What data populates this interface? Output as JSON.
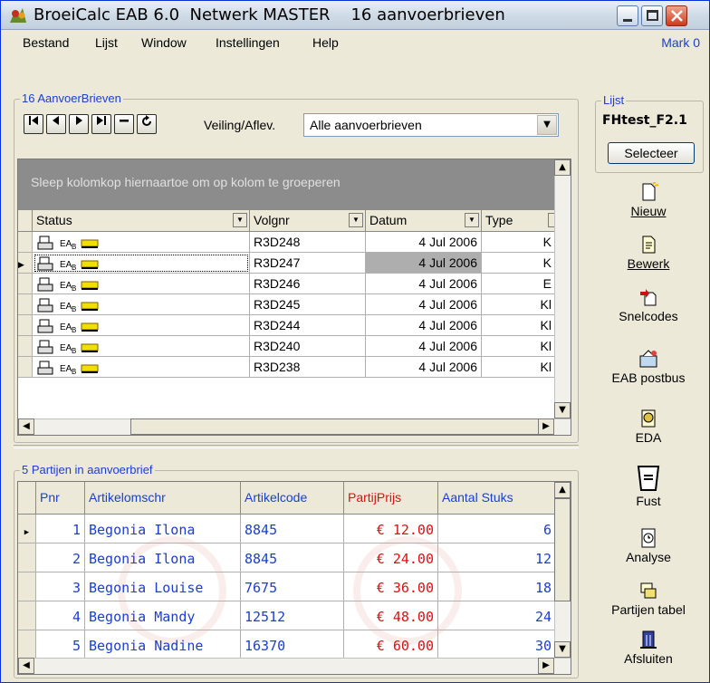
{
  "window": {
    "title": "BroeiCalc EAB 6.0  Netwerk MASTER    16 aanvoerbrieven",
    "app_icon": "broeicalc-logo-icon"
  },
  "menu": {
    "items": [
      "Bestand",
      "Lijst",
      "Window",
      "Instellingen",
      "Help"
    ],
    "user": "Mark 0"
  },
  "top_group": {
    "label": "16 AanvoerBrieven",
    "nav_buttons": [
      "first-record",
      "previous-record",
      "next-record",
      "last-record",
      "delete-record",
      "refresh"
    ],
    "veiling_label": "Veiling/Aflev.",
    "veiling_value": "Alle aanvoerbrieven",
    "group_hint": "Sleep kolomkop hiernaartoe om op kolom te groeperen",
    "columns": [
      "Status",
      "Volgnr",
      "Datum",
      "Type"
    ],
    "rows": [
      {
        "volgnr": "R3D248",
        "datum": "4 Jul 2006",
        "type": "K"
      },
      {
        "volgnr": "R3D247",
        "datum": "4 Jul 2006",
        "type": "K"
      },
      {
        "volgnr": "R3D246",
        "datum": "4 Jul 2006",
        "type": "E"
      },
      {
        "volgnr": "R3D245",
        "datum": "4 Jul 2006",
        "type": "Kl"
      },
      {
        "volgnr": "R3D244",
        "datum": "4 Jul 2006",
        "type": "Kl"
      },
      {
        "volgnr": "R3D240",
        "datum": "4 Jul 2006",
        "type": "Kl"
      },
      {
        "volgnr": "R3D238",
        "datum": "4 Jul 2006",
        "type": "Kl"
      }
    ],
    "selected_row": 1
  },
  "bottom_group": {
    "label": "5 Partijen in aanvoerbrief",
    "columns": [
      "Pnr",
      "Artikelomschr",
      "Artikelcode",
      "PartijPrijs",
      "Aantal Stuks"
    ],
    "rows": [
      {
        "pnr": "1",
        "omschr": "Begonia Ilona",
        "code": "8845",
        "prijs": "€ 12.00",
        "stuks": "6"
      },
      {
        "pnr": "2",
        "omschr": "Begonia Ilona",
        "code": "8845",
        "prijs": "€ 24.00",
        "stuks": "12"
      },
      {
        "pnr": "3",
        "omschr": "Begonia Louise",
        "code": "7675",
        "prijs": "€ 36.00",
        "stuks": "18"
      },
      {
        "pnr": "4",
        "omschr": "Begonia Mandy",
        "code": "12512",
        "prijs": "€ 48.00",
        "stuks": "24"
      },
      {
        "pnr": "5",
        "omschr": "Begonia Nadine",
        "code": "16370",
        "prijs": "€ 60.00",
        "stuks": "30"
      }
    ]
  },
  "side": {
    "lijst_label": "Lijst",
    "lijst_name": "FHtest_F2.1",
    "selecteer": "Selecteer",
    "buttons": [
      "Nieuw",
      "Bewerk",
      "Snelcodes",
      "EAB postbus",
      "EDA",
      "Fust",
      "Analyse",
      "Partijen tabel",
      "Afsluiten"
    ]
  },
  "colors": {
    "link_blue": "#1a3fd1",
    "price_red": "#e01010",
    "grid_selected": "#aeaeae"
  }
}
